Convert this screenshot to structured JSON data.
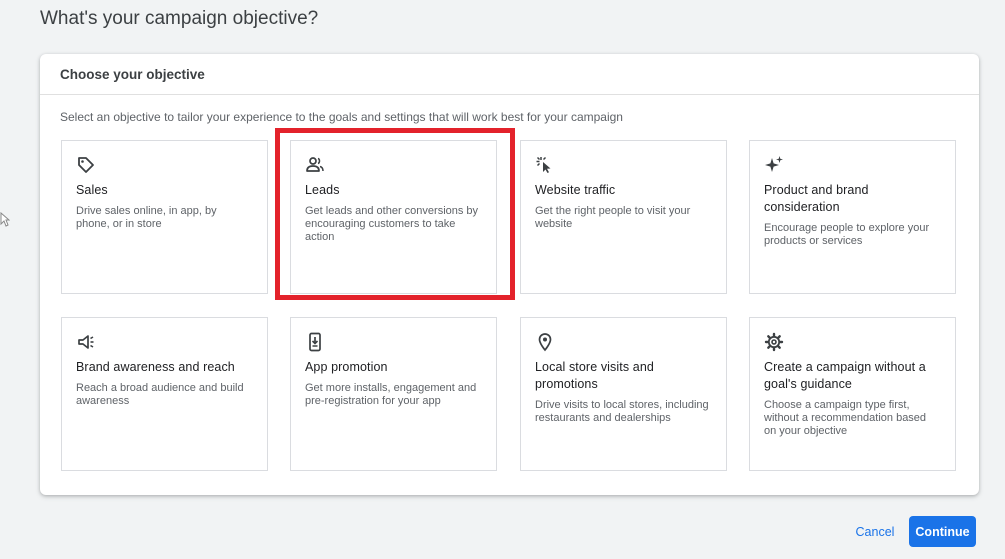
{
  "page": {
    "title": "What's your campaign objective?"
  },
  "card": {
    "header": "Choose your objective",
    "subtitle": "Select an objective to tailor your experience to the goals and settings that will work best for your campaign"
  },
  "objectives": [
    {
      "title": "Sales",
      "description": "Drive sales online, in app, by phone, or in store",
      "icon": "tag-icon"
    },
    {
      "title": "Leads",
      "description": "Get leads and other conversions by encouraging customers to take action",
      "icon": "people-icon",
      "highlighted": true
    },
    {
      "title": "Website traffic",
      "description": "Get the right people to visit your website",
      "icon": "cursor-click-icon"
    },
    {
      "title": "Product and brand consideration",
      "description": "Encourage people to explore your products or services",
      "icon": "sparkle-icon"
    },
    {
      "title": "Brand awareness and reach",
      "description": "Reach a broad audience and build awareness",
      "icon": "megaphone-icon"
    },
    {
      "title": "App promotion",
      "description": "Get more installs, engagement and pre-registration for your app",
      "icon": "phone-download-icon"
    },
    {
      "title": "Local store visits and promotions",
      "description": "Drive visits to local stores, including restaurants and dealerships",
      "icon": "map-pin-icon"
    },
    {
      "title": "Create a campaign without a goal's guidance",
      "description": "Choose a campaign type first, without a recommendation based on your objective",
      "icon": "gear-icon"
    }
  ],
  "actions": {
    "cancel": "Cancel",
    "continue": "Continue"
  },
  "colors": {
    "accent": "#1a73e8",
    "highlight": "#e3222b"
  }
}
